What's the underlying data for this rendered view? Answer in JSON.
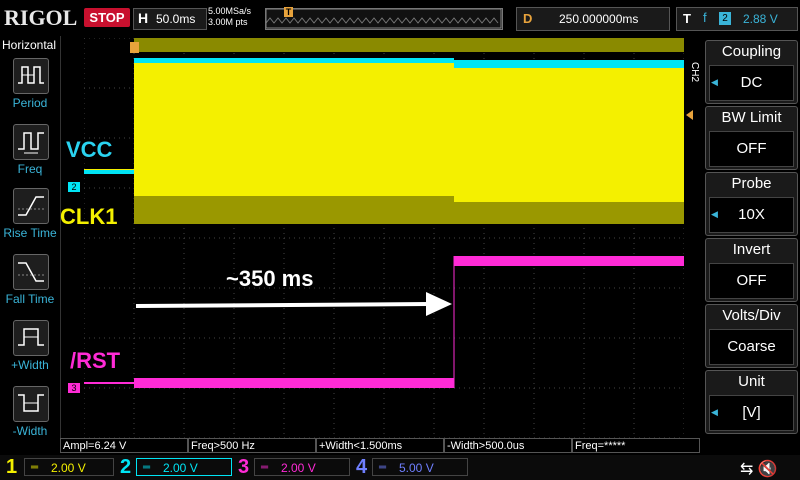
{
  "topbar": {
    "brand": "RIGOL",
    "run_state": "STOP",
    "h_label": "H",
    "timebase": "50.0ms",
    "sample_rate": "5.00MSa/s",
    "memory_depth": "3.00M pts",
    "trigger_marker": "T",
    "delay_label": "D",
    "delay_value": "250.000000ms",
    "trig_label": "T",
    "trig_edge": "f",
    "trig_source": "2",
    "trig_level": "2.88 V"
  },
  "left_panel": {
    "title": "Horizontal",
    "items": [
      {
        "label": "Period",
        "icon": "period-icon"
      },
      {
        "label": "Freq",
        "icon": "freq-icon"
      },
      {
        "label": "Rise Time",
        "icon": "rise-time-icon"
      },
      {
        "label": "Fall Time",
        "icon": "fall-time-icon"
      },
      {
        "label": "+Width",
        "icon": "pos-width-icon"
      },
      {
        "label": "-Width",
        "icon": "neg-width-icon"
      }
    ]
  },
  "right_panel": {
    "tab": "CH2",
    "items": [
      {
        "title": "Coupling",
        "value": "DC"
      },
      {
        "title": "BW Limit",
        "value": "OFF"
      },
      {
        "title": "Probe",
        "value": "10X"
      },
      {
        "title": "Invert",
        "value": "OFF"
      },
      {
        "title": "Volts/Div",
        "value": "Coarse"
      },
      {
        "title": "Unit",
        "value": "[V]"
      }
    ]
  },
  "traces": {
    "vcc_label": "VCC",
    "clk_label": "CLK1",
    "rst_label": "/RST",
    "ch2_marker": "2",
    "ch3_marker": "3",
    "annotation": "~350 ms",
    "colors": {
      "ch1": "#f4f000",
      "ch2": "#00e5f5",
      "ch3": "#ff2bd6",
      "ch4": "#6f7fff"
    }
  },
  "measurements": [
    "Ampl=6.24 V",
    "Freq>500 Hz",
    "+Width<1.500ms",
    "-Width>500.0us",
    "Freq=*****"
  ],
  "channels": [
    {
      "num": "1",
      "value": "2.00 V",
      "color": "#f4f000"
    },
    {
      "num": "2",
      "value": "2.00 V",
      "color": "#00e5f5"
    },
    {
      "num": "3",
      "value": "2.00 V",
      "color": "#ff2bd6"
    },
    {
      "num": "4",
      "value": "5.00 V",
      "color": "#6f7fff"
    }
  ]
}
